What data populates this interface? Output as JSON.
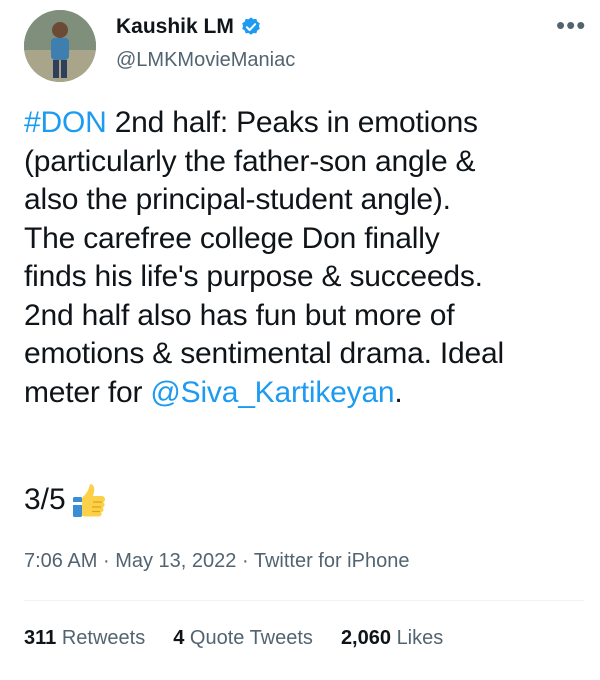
{
  "user": {
    "display_name": "Kaushik LM",
    "handle": "@LMKMovieManiac",
    "verified_icon": "verified-badge-icon",
    "avatar_icon": "profile-photo"
  },
  "menu_icon": "more-options-icon",
  "tweet": {
    "hashtag": "#DON",
    "text_part1": " 2nd half: Peaks in emotions\n(particularly the father-son angle &\nalso the principal-student angle).\nThe carefree college Don finally\nfinds his life's purpose & succeeds.\n2nd half also has fun but more of\nemotions & sentimental drama. Ideal\nmeter for ",
    "mention": "@Siva_Kartikeyan",
    "text_part2": ".",
    "rating": "3/5",
    "rating_icon": "thumbs-up-emoji"
  },
  "meta": {
    "time": "7:06 AM",
    "separator": "·",
    "date": "May 13, 2022",
    "source": "Twitter for iPhone"
  },
  "stats": {
    "retweets_count": "311",
    "retweets_label": "Retweets",
    "quotes_count": "4",
    "quotes_label": "Quote Tweets",
    "likes_count": "2,060",
    "likes_label": "Likes"
  },
  "colors": {
    "link": "#1d9bf0",
    "text": "#0f1419",
    "secondary": "#536471"
  }
}
